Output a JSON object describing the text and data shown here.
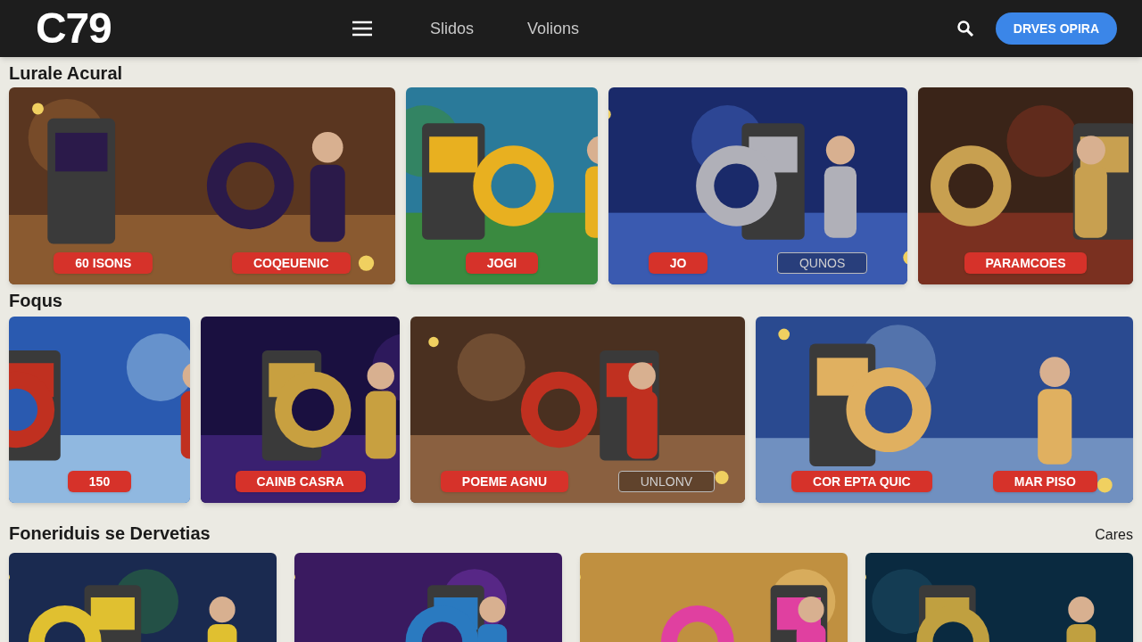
{
  "header": {
    "logo": "C79",
    "nav": [
      {
        "label": "Slidos"
      },
      {
        "label": "Volions"
      }
    ],
    "cta": "DRVES OPIRA"
  },
  "sections": [
    {
      "title": "Lurale Acural",
      "cards": [
        {
          "kind": "picture",
          "buttons": [
            {
              "label": "60 ISONS",
              "kind": "solid"
            },
            {
              "label": "COQEUENIC",
              "kind": "solid"
            }
          ]
        },
        {
          "kind": "picture",
          "buttons": [
            {
              "label": "JOGI",
              "kind": "solid"
            }
          ]
        },
        {
          "kind": "picture",
          "buttons": [
            {
              "label": "JO",
              "kind": "solid"
            },
            {
              "label": "QUNOS",
              "kind": "outline"
            }
          ]
        },
        {
          "kind": "picture",
          "buttons": [
            {
              "label": "PARAMCOES",
              "kind": "solid"
            }
          ]
        }
      ]
    },
    {
      "title": "Foqus",
      "cards": [
        {
          "kind": "picture",
          "buttons": [
            {
              "label": "150",
              "kind": "solid"
            }
          ]
        },
        {
          "kind": "picture",
          "buttons": [
            {
              "label": "CAINB CASRA",
              "kind": "solid"
            }
          ]
        },
        {
          "kind": "picture",
          "buttons": [
            {
              "label": "POEME AGNU",
              "kind": "solid"
            },
            {
              "label": "UNLONV",
              "kind": "outline"
            }
          ]
        },
        {
          "kind": "picture",
          "buttons": [
            {
              "label": "COR EPTA QUIC",
              "kind": "solid"
            },
            {
              "label": "MAR PISO",
              "kind": "solid"
            }
          ]
        }
      ]
    },
    {
      "title": "Foneriduis se Dervetias",
      "link": "Cares"
    }
  ]
}
